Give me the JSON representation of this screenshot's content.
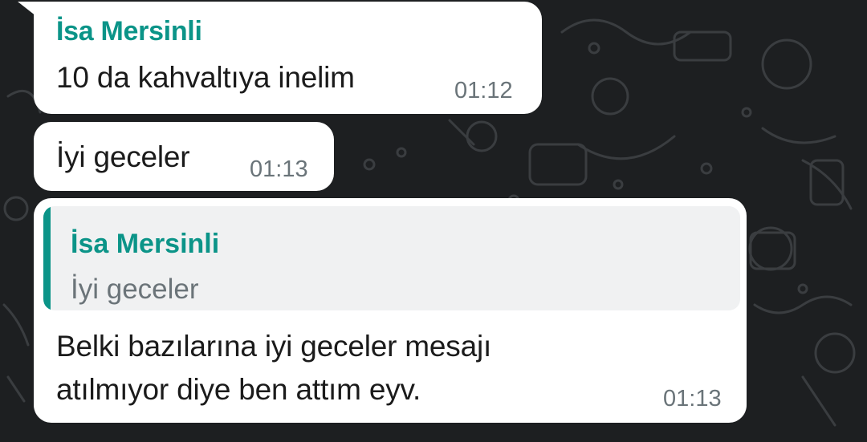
{
  "messages": [
    {
      "sender": "İsa Mersinli",
      "text": "10 da kahvaltıya inelim",
      "time": "01:12"
    },
    {
      "text": "İyi geceler",
      "time": "01:13"
    },
    {
      "quoted": {
        "sender": "İsa Mersinli",
        "text": "İyi geceler"
      },
      "text_line1": "Belki bazılarına iyi geceler mesajı",
      "text_line2": "atılmıyor diye ben attım eyv.",
      "time": "01:13"
    }
  ],
  "theme": {
    "background": "#1d1f21",
    "bubble": "#ffffff",
    "accent": "#0b9488"
  }
}
